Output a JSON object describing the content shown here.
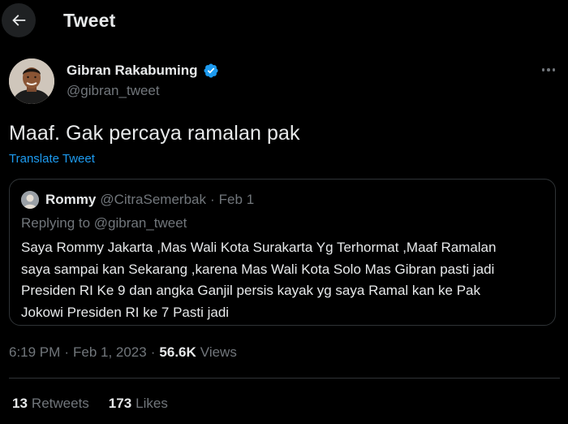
{
  "header": {
    "title": "Tweet",
    "back_icon": "arrow-left-icon"
  },
  "author": {
    "name": "Gibran Rakabuming",
    "handle": "@gibran_tweet",
    "verified": true,
    "verified_color": "#1d9bf0"
  },
  "tweet": {
    "text": "Maaf. Gak percaya ramalan pak",
    "translate_label": "Translate Tweet"
  },
  "quoted": {
    "name": "Rommy",
    "handle": "@CitraSemerbak",
    "separator": "·",
    "date": "Feb 1",
    "replying_to": "Replying to @gibran_tweet",
    "lines": [
      "Saya Rommy Jakarta ,Mas Wali Kota Surakarta Yg Terhormat ,Maaf Ramalan",
      "saya sampai kan Sekarang ,karena Mas Wali Kota Solo Mas Gibran pasti jadi",
      "Presiden RI Ke 9 dan angka Ganjil persis kayak yg saya Ramal kan ke Pak",
      "Jokowi Presiden RI ke 7 Pasti jadi"
    ]
  },
  "meta": {
    "time": "6:19 PM",
    "separator": "·",
    "date": "Feb 1, 2023",
    "views_count": "56.6K",
    "views_label": "Views"
  },
  "stats": {
    "retweets_count": "13",
    "retweets_label": "Retweets",
    "likes_count": "173",
    "likes_label": "Likes"
  },
  "colors": {
    "background": "#000000",
    "text": "#e7e9ea",
    "secondary": "#71767b",
    "link": "#1d9bf0",
    "border": "#2f3336"
  }
}
